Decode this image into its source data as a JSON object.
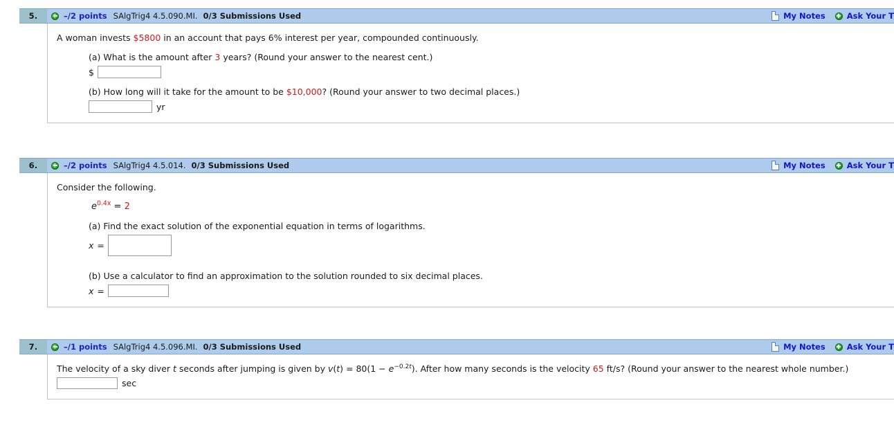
{
  "questions": [
    {
      "number": "5.",
      "points": "–/2 points",
      "code": "SAlgTrig4 4.5.090.MI.",
      "submissions": "0/3 Submissions Used",
      "my_notes": "My Notes",
      "ask_teacher": "Ask Your T",
      "statement_pre": "A woman invests ",
      "statement_val": "$5800",
      "statement_post": " in an account that pays 6% interest per year, compounded continuously.",
      "part_a_pre": "(a) What is the amount after ",
      "part_a_val": "3",
      "part_a_post": " years? (Round your answer to the nearest cent.)",
      "part_a_prefix_label": "$",
      "part_a_input_value": "",
      "part_b_pre": "(b) How long will it take for the amount to be ",
      "part_b_val": "$10,000",
      "part_b_post": "? (Round your answer to two decimal places.)",
      "part_b_unit_label": "yr",
      "part_b_input_value": ""
    },
    {
      "number": "6.",
      "points": "–/2 points",
      "code": "SAlgTrig4 4.5.014.",
      "submissions": "0/3 Submissions Used",
      "my_notes": "My Notes",
      "ask_teacher": "Ask Your T",
      "statement": "Consider the following.",
      "equation_base": "e",
      "equation_exponent": "0.4x",
      "equation_equals": " = ",
      "equation_rhs": "2",
      "part_a": "(a) Find the exact solution of the exponential equation in terms of logarithms.",
      "part_a_var": "x",
      "part_a_equals": " = ",
      "part_a_input_value": "",
      "part_b": "(b) Use a calculator to find an approximation to the solution rounded to six decimal places.",
      "part_b_var": "x",
      "part_b_equals": " = ",
      "part_b_input_value": ""
    },
    {
      "number": "7.",
      "points": "–/1 points",
      "code": "SAlgTrig4 4.5.096.MI.",
      "submissions": "0/3 Submissions Used",
      "my_notes": "My Notes",
      "ask_teacher": "Ask Your T",
      "stmt_1": "The velocity of a sky diver ",
      "stmt_var_t": "t",
      "stmt_2": " seconds after jumping is given by ",
      "stmt_var_v": "v",
      "stmt_3": "(",
      "stmt_var_t2": "t",
      "stmt_4": ") = 80(1 − ",
      "stmt_e": "e",
      "stmt_exp_sign": "−0.2",
      "stmt_exp_var": "t",
      "stmt_5": "). After how many seconds is the velocity ",
      "stmt_val": "65",
      "stmt_6": " ft/s? (Round your answer to the nearest whole number.)",
      "unit_label": "sec",
      "input_value": ""
    }
  ]
}
